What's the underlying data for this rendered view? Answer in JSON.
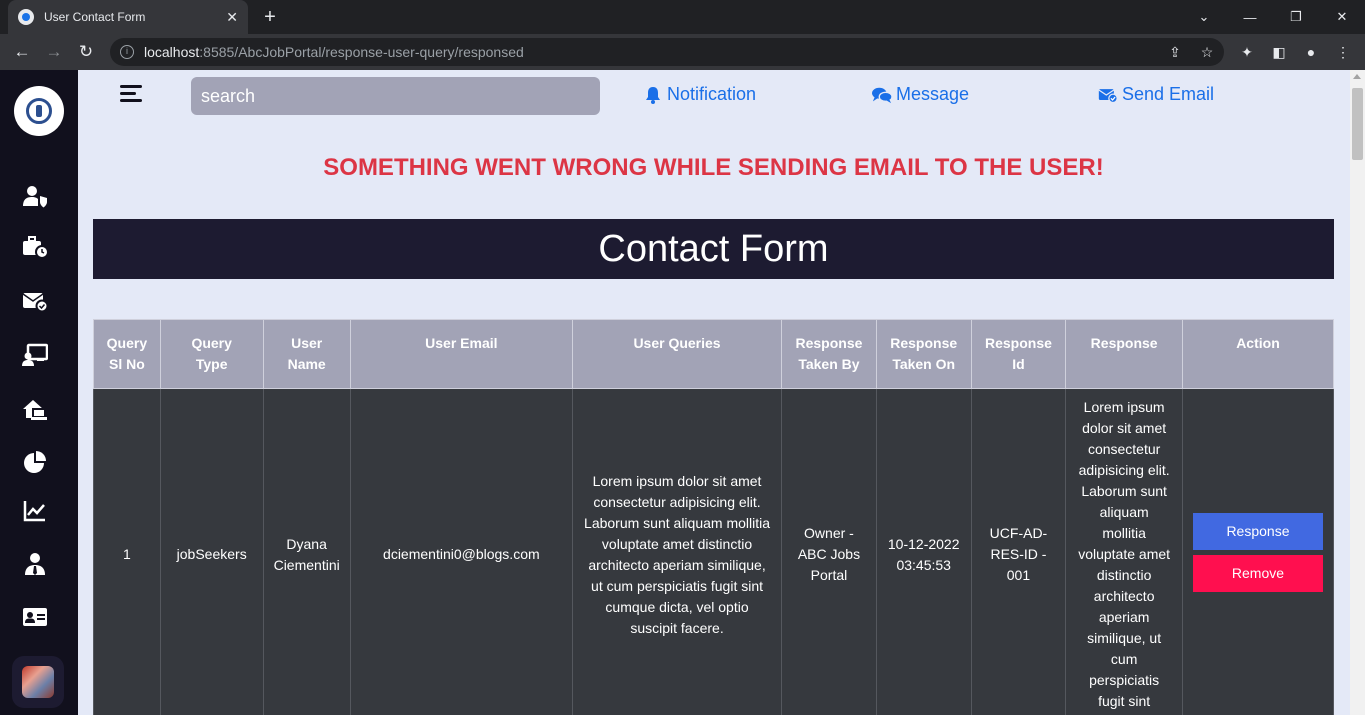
{
  "browser": {
    "tab_title": "User Contact Form",
    "url_host": "localhost",
    "url_rest": ":8585/AbcJobPortal/response-user-query/responsed"
  },
  "header": {
    "search_placeholder": "search",
    "notification_label": "Notification",
    "message_label": "Message",
    "send_email_label": "Send Email"
  },
  "alert": {
    "text": "SOMETHING WENT WRONG WHILE SENDING EMAIL TO THE USER!",
    "color": "#dc3545"
  },
  "form_title": "Contact Form",
  "table": {
    "headers": {
      "sl_no": [
        "Query",
        "Sl No"
      ],
      "type": [
        "Query",
        "Type"
      ],
      "name": [
        "User",
        "Name"
      ],
      "email": "User Email",
      "queries": "User Queries",
      "taken_by": [
        "Response",
        "Taken By"
      ],
      "taken_on": [
        "Response",
        "Taken On"
      ],
      "resp_id": [
        "Response",
        "Id"
      ],
      "response": "Response",
      "action": "Action"
    },
    "rows": [
      {
        "sl_no": "1",
        "type": "jobSeekers",
        "name": "Dyana Ciementini",
        "email": "dciementini0@blogs.com",
        "query": "Lorem ipsum dolor sit amet consectetur adipisicing elit. Laborum sunt aliquam mollitia voluptate amet distinctio architecto aperiam similique, ut cum perspiciatis fugit sint cumque dicta, vel optio suscipit facere.",
        "taken_by": "Owner - ABC Jobs Portal",
        "taken_on": "10-12-2022 03:45:53",
        "resp_id": "UCF-AD-RES-ID - 001",
        "response": "Lorem ipsum dolor sit amet consectetur adipisicing elit. Laborum sunt aliquam mollitia voluptate amet distinctio architecto aperiam similique, ut cum perspiciatis fugit sint",
        "response_button": "Response",
        "remove_button": "Remove"
      }
    ]
  },
  "colors": {
    "sidebar": "#11101d",
    "page_bg": "#e4e9f7",
    "header_row": "#a2a3b6",
    "row_bg": "#36393e",
    "accent_link": "#1a6fe8",
    "response_btn": "#4169e1",
    "remove_btn": "#ff0f4f"
  },
  "sidebar_icons": [
    "user-shield-icon",
    "briefcase-clock-icon",
    "envelope-check-icon",
    "chalkboard-user-icon",
    "house-laptop-icon",
    "chart-pie-icon",
    "chart-line-icon",
    "user-tie-icon",
    "id-card-icon"
  ]
}
